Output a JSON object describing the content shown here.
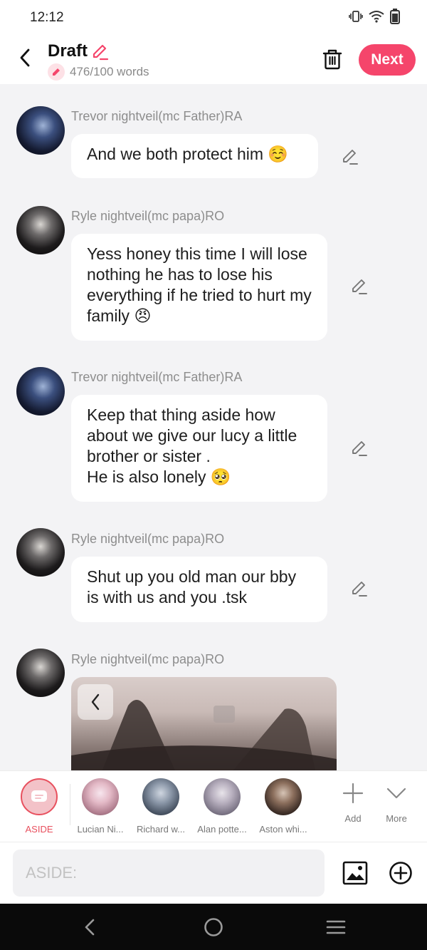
{
  "status_bar": {
    "time": "12:12"
  },
  "header": {
    "title": "Draft",
    "word_count": "476/100 words",
    "next_label": "Next"
  },
  "messages": [
    {
      "sender": "Trevor nightveil(mc Father)RA",
      "text": "And we both protect him ☺️"
    },
    {
      "sender": "Ryle nightveil(mc papa)RO",
      "text": "Yess honey this time I will lose nothing he has to lose his everything if he tried to hurt my family 😠"
    },
    {
      "sender": "Trevor nightveil(mc Father)RA",
      "text": "Keep that thing aside how about we give our lucy a little brother or sister .\nHe is also lonely 🥺"
    },
    {
      "sender": "Ryle nightveil(mc papa)RO",
      "text": "Shut up you old man our bby is with us and you .tsk"
    },
    {
      "sender": "Ryle nightveil(mc papa)RO",
      "text": ""
    }
  ],
  "characters": [
    {
      "name": "ASIDE"
    },
    {
      "name": "Lucian Ni..."
    },
    {
      "name": "Richard w..."
    },
    {
      "name": "Alan potte..."
    },
    {
      "name": "Aston whi..."
    }
  ],
  "tools": {
    "add_label": "Add",
    "more_label": "More"
  },
  "input": {
    "placeholder": "ASIDE:"
  },
  "colors": {
    "accent": "#f5456b",
    "aside": "#e8505e"
  }
}
